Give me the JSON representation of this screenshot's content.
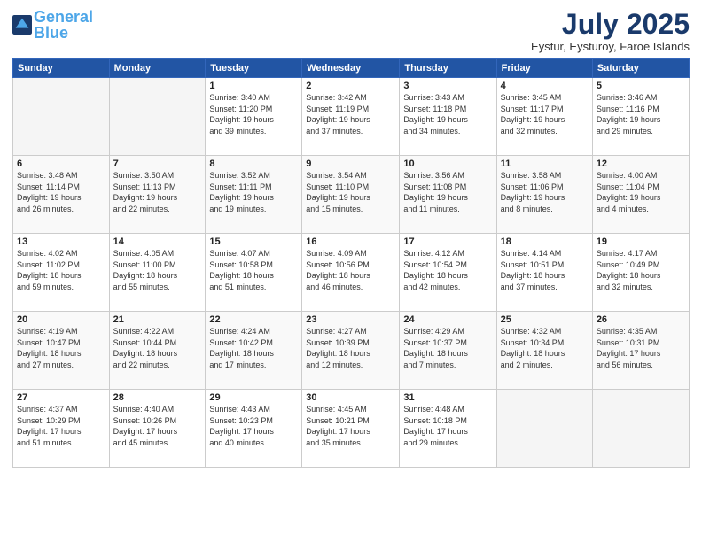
{
  "logo": {
    "line1": "General",
    "line2": "Blue"
  },
  "title": "July 2025",
  "subtitle": "Eystur, Eysturoy, Faroe Islands",
  "weekdays": [
    "Sunday",
    "Monday",
    "Tuesday",
    "Wednesday",
    "Thursday",
    "Friday",
    "Saturday"
  ],
  "weeks": [
    [
      {
        "day": "",
        "info": ""
      },
      {
        "day": "",
        "info": ""
      },
      {
        "day": "1",
        "info": "Sunrise: 3:40 AM\nSunset: 11:20 PM\nDaylight: 19 hours\nand 39 minutes."
      },
      {
        "day": "2",
        "info": "Sunrise: 3:42 AM\nSunset: 11:19 PM\nDaylight: 19 hours\nand 37 minutes."
      },
      {
        "day": "3",
        "info": "Sunrise: 3:43 AM\nSunset: 11:18 PM\nDaylight: 19 hours\nand 34 minutes."
      },
      {
        "day": "4",
        "info": "Sunrise: 3:45 AM\nSunset: 11:17 PM\nDaylight: 19 hours\nand 32 minutes."
      },
      {
        "day": "5",
        "info": "Sunrise: 3:46 AM\nSunset: 11:16 PM\nDaylight: 19 hours\nand 29 minutes."
      }
    ],
    [
      {
        "day": "6",
        "info": "Sunrise: 3:48 AM\nSunset: 11:14 PM\nDaylight: 19 hours\nand 26 minutes."
      },
      {
        "day": "7",
        "info": "Sunrise: 3:50 AM\nSunset: 11:13 PM\nDaylight: 19 hours\nand 22 minutes."
      },
      {
        "day": "8",
        "info": "Sunrise: 3:52 AM\nSunset: 11:11 PM\nDaylight: 19 hours\nand 19 minutes."
      },
      {
        "day": "9",
        "info": "Sunrise: 3:54 AM\nSunset: 11:10 PM\nDaylight: 19 hours\nand 15 minutes."
      },
      {
        "day": "10",
        "info": "Sunrise: 3:56 AM\nSunset: 11:08 PM\nDaylight: 19 hours\nand 11 minutes."
      },
      {
        "day": "11",
        "info": "Sunrise: 3:58 AM\nSunset: 11:06 PM\nDaylight: 19 hours\nand 8 minutes."
      },
      {
        "day": "12",
        "info": "Sunrise: 4:00 AM\nSunset: 11:04 PM\nDaylight: 19 hours\nand 4 minutes."
      }
    ],
    [
      {
        "day": "13",
        "info": "Sunrise: 4:02 AM\nSunset: 11:02 PM\nDaylight: 18 hours\nand 59 minutes."
      },
      {
        "day": "14",
        "info": "Sunrise: 4:05 AM\nSunset: 11:00 PM\nDaylight: 18 hours\nand 55 minutes."
      },
      {
        "day": "15",
        "info": "Sunrise: 4:07 AM\nSunset: 10:58 PM\nDaylight: 18 hours\nand 51 minutes."
      },
      {
        "day": "16",
        "info": "Sunrise: 4:09 AM\nSunset: 10:56 PM\nDaylight: 18 hours\nand 46 minutes."
      },
      {
        "day": "17",
        "info": "Sunrise: 4:12 AM\nSunset: 10:54 PM\nDaylight: 18 hours\nand 42 minutes."
      },
      {
        "day": "18",
        "info": "Sunrise: 4:14 AM\nSunset: 10:51 PM\nDaylight: 18 hours\nand 37 minutes."
      },
      {
        "day": "19",
        "info": "Sunrise: 4:17 AM\nSunset: 10:49 PM\nDaylight: 18 hours\nand 32 minutes."
      }
    ],
    [
      {
        "day": "20",
        "info": "Sunrise: 4:19 AM\nSunset: 10:47 PM\nDaylight: 18 hours\nand 27 minutes."
      },
      {
        "day": "21",
        "info": "Sunrise: 4:22 AM\nSunset: 10:44 PM\nDaylight: 18 hours\nand 22 minutes."
      },
      {
        "day": "22",
        "info": "Sunrise: 4:24 AM\nSunset: 10:42 PM\nDaylight: 18 hours\nand 17 minutes."
      },
      {
        "day": "23",
        "info": "Sunrise: 4:27 AM\nSunset: 10:39 PM\nDaylight: 18 hours\nand 12 minutes."
      },
      {
        "day": "24",
        "info": "Sunrise: 4:29 AM\nSunset: 10:37 PM\nDaylight: 18 hours\nand 7 minutes."
      },
      {
        "day": "25",
        "info": "Sunrise: 4:32 AM\nSunset: 10:34 PM\nDaylight: 18 hours\nand 2 minutes."
      },
      {
        "day": "26",
        "info": "Sunrise: 4:35 AM\nSunset: 10:31 PM\nDaylight: 17 hours\nand 56 minutes."
      }
    ],
    [
      {
        "day": "27",
        "info": "Sunrise: 4:37 AM\nSunset: 10:29 PM\nDaylight: 17 hours\nand 51 minutes."
      },
      {
        "day": "28",
        "info": "Sunrise: 4:40 AM\nSunset: 10:26 PM\nDaylight: 17 hours\nand 45 minutes."
      },
      {
        "day": "29",
        "info": "Sunrise: 4:43 AM\nSunset: 10:23 PM\nDaylight: 17 hours\nand 40 minutes."
      },
      {
        "day": "30",
        "info": "Sunrise: 4:45 AM\nSunset: 10:21 PM\nDaylight: 17 hours\nand 35 minutes."
      },
      {
        "day": "31",
        "info": "Sunrise: 4:48 AM\nSunset: 10:18 PM\nDaylight: 17 hours\nand 29 minutes."
      },
      {
        "day": "",
        "info": ""
      },
      {
        "day": "",
        "info": ""
      }
    ]
  ]
}
